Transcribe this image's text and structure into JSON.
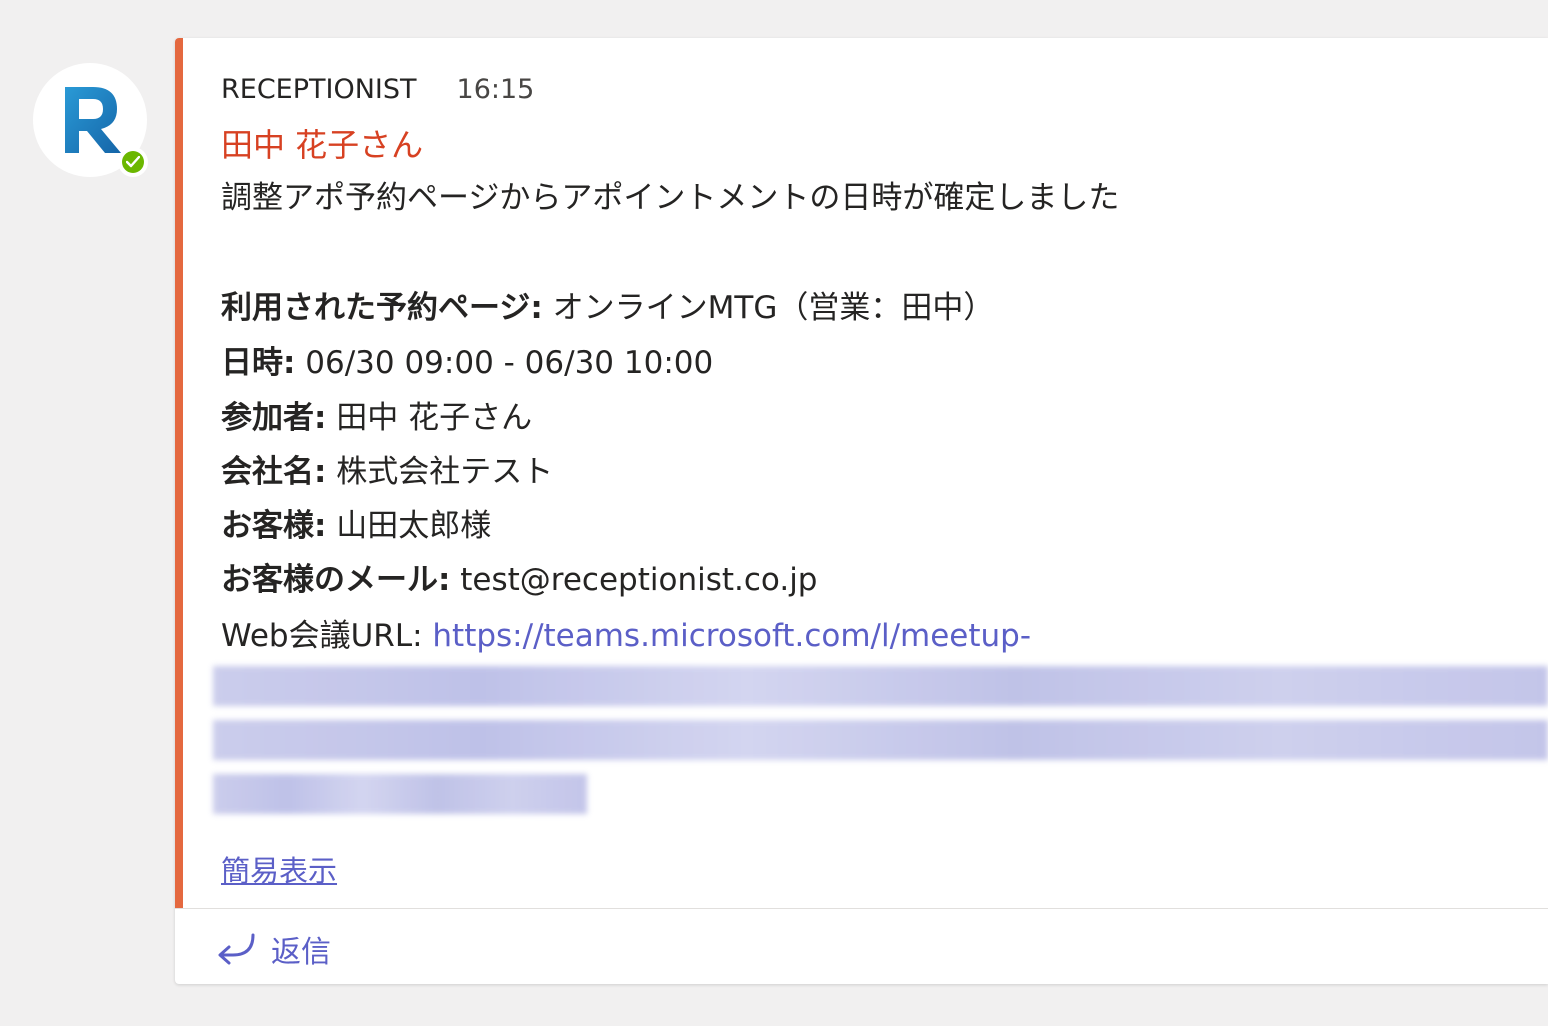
{
  "colors": {
    "accent": "#e4683f",
    "mention": "#d74122",
    "link": "#5b5fc7",
    "presence": "#6bb700"
  },
  "avatar": {
    "icon": "receptionist-logo-icon",
    "status_icon": "available-check-icon"
  },
  "message": {
    "sender": "RECEPTIONIST",
    "time": "16:15",
    "mention": "田中 花子さん",
    "intro": "調整アポ予約ページからアポイントメントの日時が確定しました",
    "fields": [
      {
        "label": "利用された予約ページ:",
        "value": " オンラインMTG（営業：田中）"
      },
      {
        "label": "日時:",
        "value": " 06/30 09:00 - 06/30 10:00"
      },
      {
        "label": "参加者:",
        "value": " 田中 花子さん"
      },
      {
        "label": "会社名:",
        "value": " 株式会社テスト"
      },
      {
        "label": "お客様:",
        "value": " 山田太郎様"
      },
      {
        "label": "お客様のメール:",
        "value": " test@receptionist.co.jp"
      }
    ],
    "web_meeting_label": "Web会議URL: ",
    "web_meeting_url": "https://teams.microsoft.com/l/meetup-",
    "simple_view_link": "簡易表示"
  },
  "footer": {
    "reply_label": "返信",
    "reply_icon": "reply-arrow-icon"
  }
}
